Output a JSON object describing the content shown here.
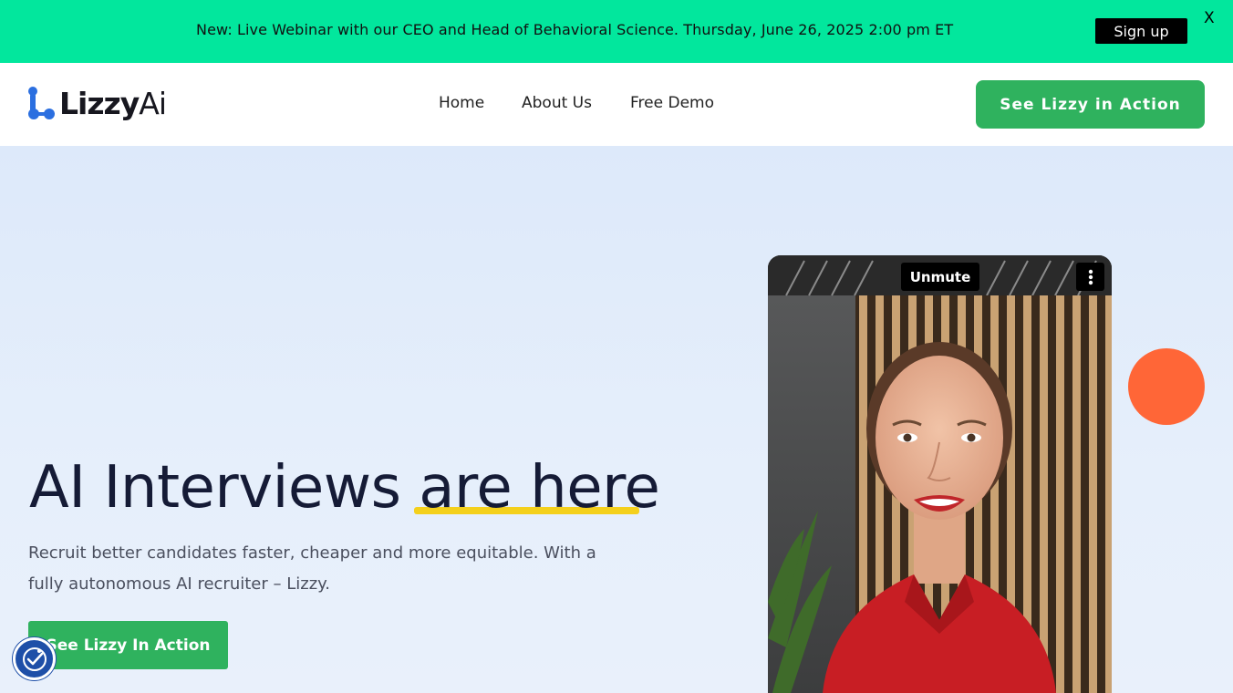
{
  "banner": {
    "text": "New: Live Webinar with our CEO and Head of Behavioral Science. Thursday, June 26, 2025 2:00 pm ET",
    "signup_label": "Sign up",
    "close_label": "X"
  },
  "header": {
    "logo_bold": "Lizzy",
    "logo_light": "Ai",
    "nav": [
      {
        "label": "Home"
      },
      {
        "label": "About Us"
      },
      {
        "label": "Free Demo"
      }
    ],
    "cta_label": "See Lizzy in Action"
  },
  "hero": {
    "headline_part1": "AI Interviews",
    "headline_part2": "are here",
    "subtext": "Recruit better candidates faster, cheaper and more equitable. With a fully autonomous AI recruiter – Lizzy.",
    "cta_label": "See Lizzy In Action"
  },
  "video": {
    "unmute_label": "Unmute"
  },
  "colors": {
    "banner": "#02e79d",
    "cta_green": "#2fb25e",
    "accent_orange": "#ff6637",
    "underline_yellow": "#f4d01c",
    "logo_blue": "#2b6fe0"
  },
  "icons": {
    "more_options": "kebab-icon",
    "accessibility": "accessibility-icon"
  }
}
